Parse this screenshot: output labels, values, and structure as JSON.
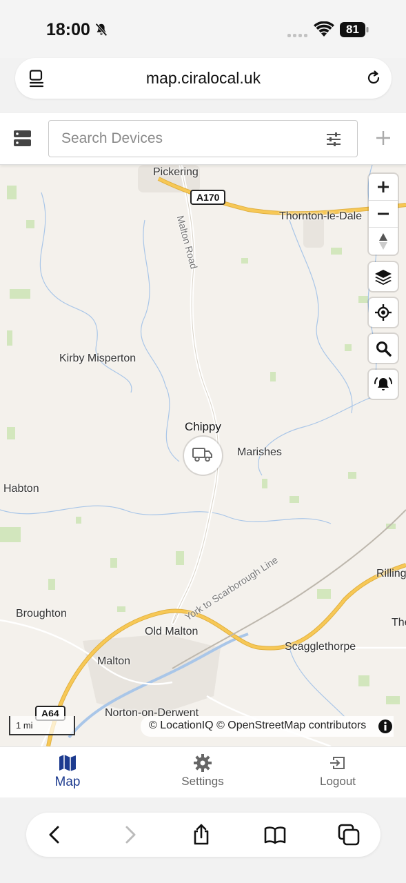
{
  "status": {
    "time": "18:00",
    "battery": "81"
  },
  "browser": {
    "url": "map.ciralocal.uk"
  },
  "header": {
    "search_placeholder": "Search Devices"
  },
  "map": {
    "places": [
      "Pickering",
      "Thornton-le-Dale",
      "Kirby Misperton",
      "Marishes",
      "Habton",
      "Rilling",
      "Broughton",
      "Old Malton",
      "Scagglethorpe",
      "The",
      "Malton",
      "Norton-on-Derwent"
    ],
    "roads": {
      "a170": "A170",
      "a64": "A64",
      "malton_road": "Malton Road",
      "rail": "York to Scarborough Line"
    },
    "device": {
      "name": "Chippy",
      "icon": "truck-icon"
    },
    "scale": "1 mi",
    "attribution": "© LocationIQ © OpenStreetMap contributors"
  },
  "nav": {
    "items": [
      {
        "label": "Map",
        "icon": "map-icon",
        "active": true
      },
      {
        "label": "Settings",
        "icon": "gear-icon",
        "active": false
      },
      {
        "label": "Logout",
        "icon": "logout-icon",
        "active": false
      }
    ]
  },
  "colors": {
    "accent": "#1d3b8f",
    "road_major": "#f7c856",
    "water": "#a9c6e8",
    "land": "#f4f1ec",
    "green": "#c9e5b0"
  }
}
